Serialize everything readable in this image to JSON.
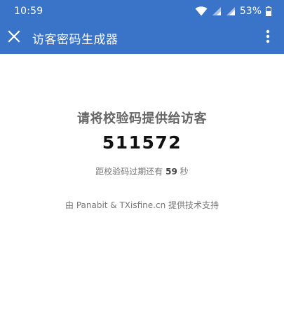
{
  "statusbar": {
    "time": "10:59",
    "battery_percent": "53%",
    "icons": [
      "wifi-icon",
      "signal-icon",
      "signal-icon",
      "battery-icon"
    ]
  },
  "appbar": {
    "title": "访客密码生成器",
    "close_icon": "close-icon",
    "menu_icon": "more-vert-icon",
    "color": "#3a74c8"
  },
  "main": {
    "heading": "请将校验码提供给访客",
    "code": "511572",
    "countdown_prefix": "距校验码过期还有",
    "countdown_seconds": "59",
    "countdown_suffix": "秒",
    "footer": "由 Panabit & TXisfine.cn 提供技术支持"
  }
}
